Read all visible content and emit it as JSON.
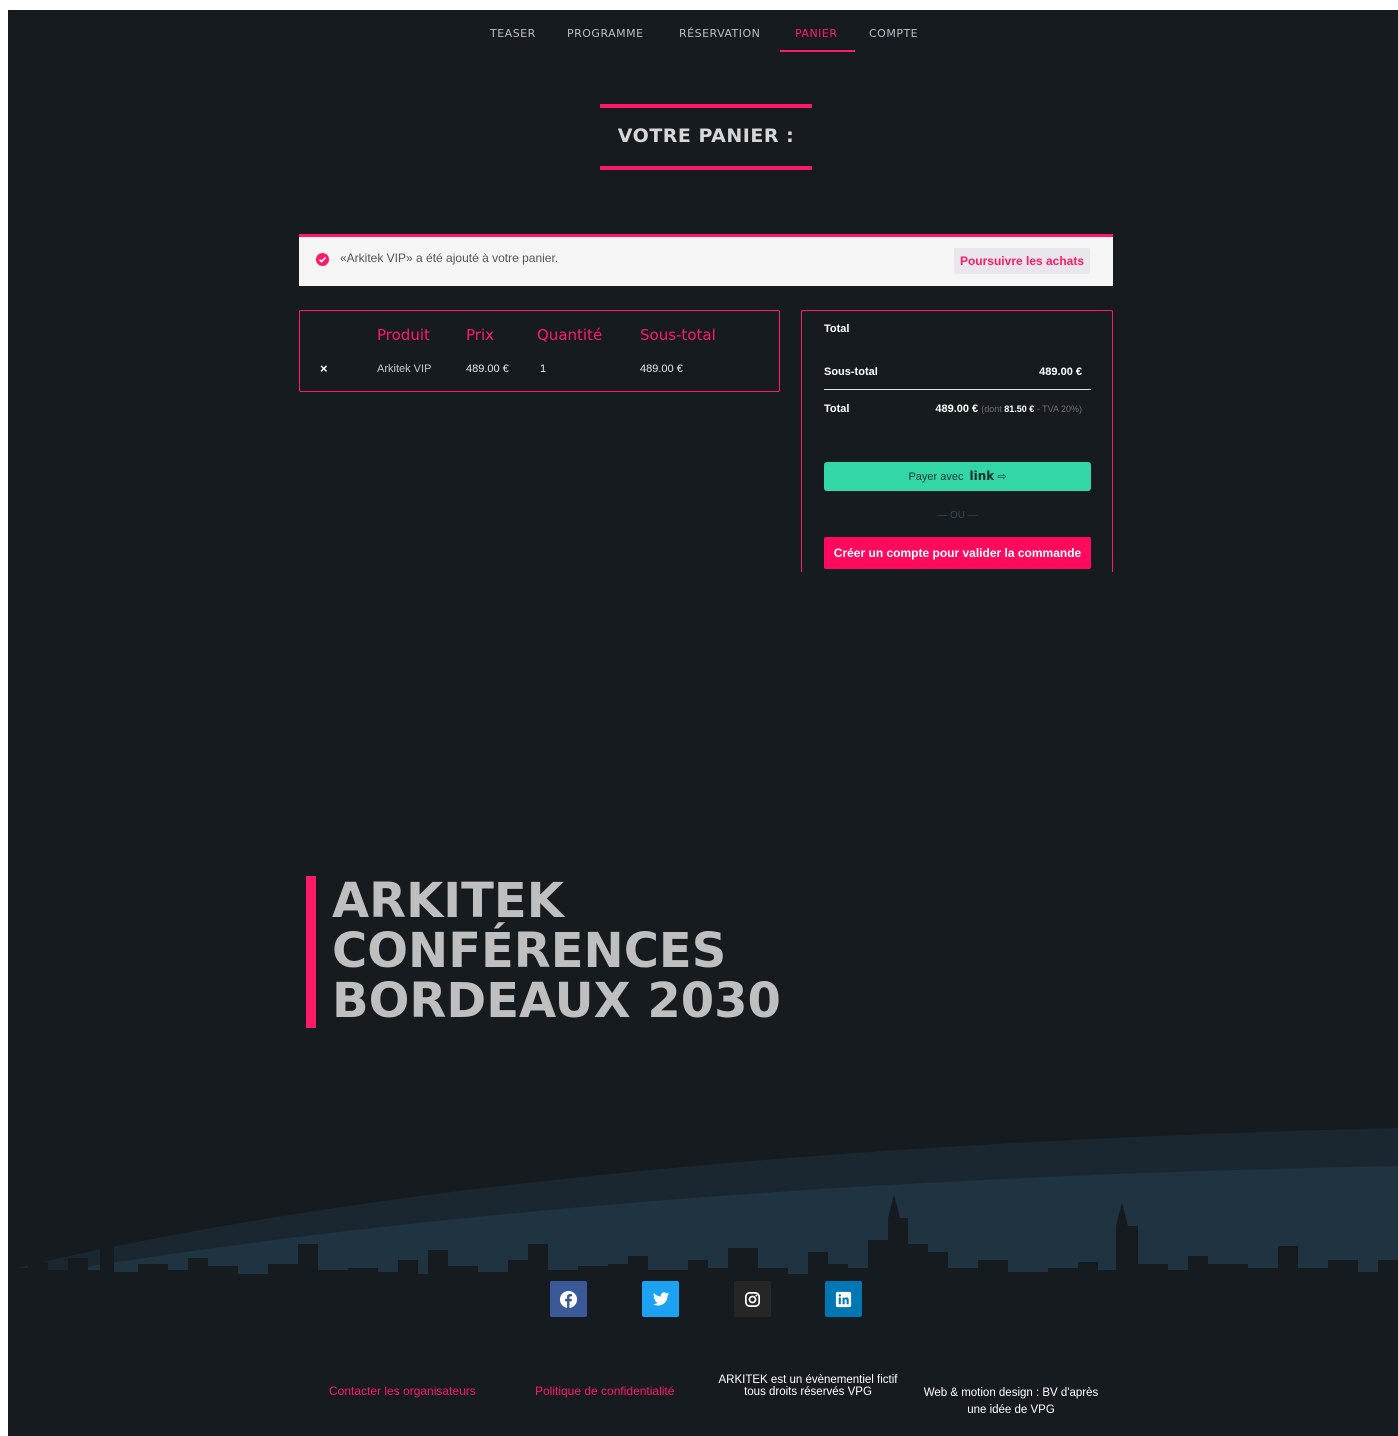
{
  "nav": {
    "items": [
      {
        "label": "TEASER"
      },
      {
        "label": "PROGRAMME"
      },
      {
        "label": "RÉSERVATION"
      },
      {
        "label": "PANIER",
        "active": true
      },
      {
        "label": "COMPTE"
      }
    ]
  },
  "page_title": "VOTRE PANIER :",
  "notice": {
    "message": "«Arkitek VIP» a été ajouté à votre panier.",
    "button": "Poursuivre les achats"
  },
  "cart": {
    "headers": [
      "Produit",
      "Prix",
      "Quantité",
      "Sous-total"
    ],
    "rows": [
      {
        "remove": "×",
        "product": "Arkitek VIP",
        "price": "489.00 €",
        "quantity": "1",
        "subtotal": "489.00 €"
      }
    ]
  },
  "totals": {
    "heading": "Total",
    "subtotal_label": "Sous-total",
    "subtotal_value": "489.00 €",
    "total_label": "Total",
    "total_value": "489.00 €",
    "tax_prefix": "(dont",
    "tax_amount": "81.50 €",
    "tax_suffix": "- TVA 20%)",
    "link_button_text": "Payer avec",
    "link_logo": "link",
    "link_arrow": "⇨",
    "separator": "— OU —",
    "create_button": "Créer un compte pour valider la commande"
  },
  "hero": {
    "lines": [
      "ARKITEK",
      "CONFÉRENCES",
      "BORDEAUX 2030"
    ]
  },
  "social": [
    {
      "icon": "facebook-icon",
      "color": "#3b5998"
    },
    {
      "icon": "twitter-icon",
      "color": "#1da1f2"
    },
    {
      "icon": "instagram-icon",
      "color": "#262626"
    },
    {
      "icon": "linkedin-icon",
      "color": "#0077b5"
    }
  ],
  "footer": {
    "contact": "Contacter les organisateurs",
    "privacy": "Politique de confidentialité",
    "disclaimer_line1": "ARKITEK est un évènementiel fictif",
    "disclaimer_line2": "tous droits réservés VPG",
    "credits_line1": "Web & motion design : BV d'après",
    "credits_line2": "une idée de VPG"
  },
  "colors": {
    "accent": "#ff1a66",
    "background": "#161b20",
    "link_green": "#33d6a6"
  }
}
